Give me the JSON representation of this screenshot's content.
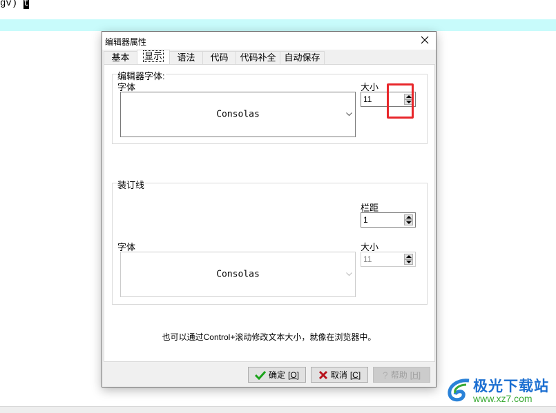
{
  "background_editor": {
    "line_text": "gv) ",
    "cursor_char": "t"
  },
  "dialog": {
    "title": "编辑器属性",
    "close_icon": "close-icon",
    "tabs": [
      {
        "label": "基本",
        "active": false
      },
      {
        "label": "显示",
        "active": true
      },
      {
        "label": "语法",
        "active": false
      },
      {
        "label": "代码",
        "active": false
      },
      {
        "label": "代码补全",
        "active": false
      },
      {
        "label": "自动保存",
        "active": false
      }
    ],
    "editor_font_group": {
      "title": "编辑器字体:",
      "font_label": "字体",
      "font_value": "Consolas",
      "size_label": "大小",
      "size_value": "11"
    },
    "gutter_group": {
      "title": "装订线",
      "spacing_label": "栏距",
      "spacing_value": "1",
      "font_label": "字体",
      "font_value": "Consolas",
      "size_label": "大小",
      "size_value": "11"
    },
    "hint": "也可以通过Control+滚动修改文本大小，就像在浏览器中。",
    "buttons": {
      "ok": {
        "label": "确定",
        "shortcut": "O",
        "icon": "check-icon"
      },
      "cancel": {
        "label": "取消",
        "shortcut": "C",
        "icon": "x-icon"
      },
      "help": {
        "label": "帮助",
        "shortcut": "H",
        "icon": "question-icon",
        "disabled": true
      }
    }
  },
  "watermark": {
    "title": "极光下载站",
    "url": "www.xz7.com"
  },
  "colors": {
    "highlight_line": "#c8fbfb",
    "annotation_red": "#e8262a",
    "ok_green": "#1aa31a",
    "cancel_red": "#b8121b"
  }
}
